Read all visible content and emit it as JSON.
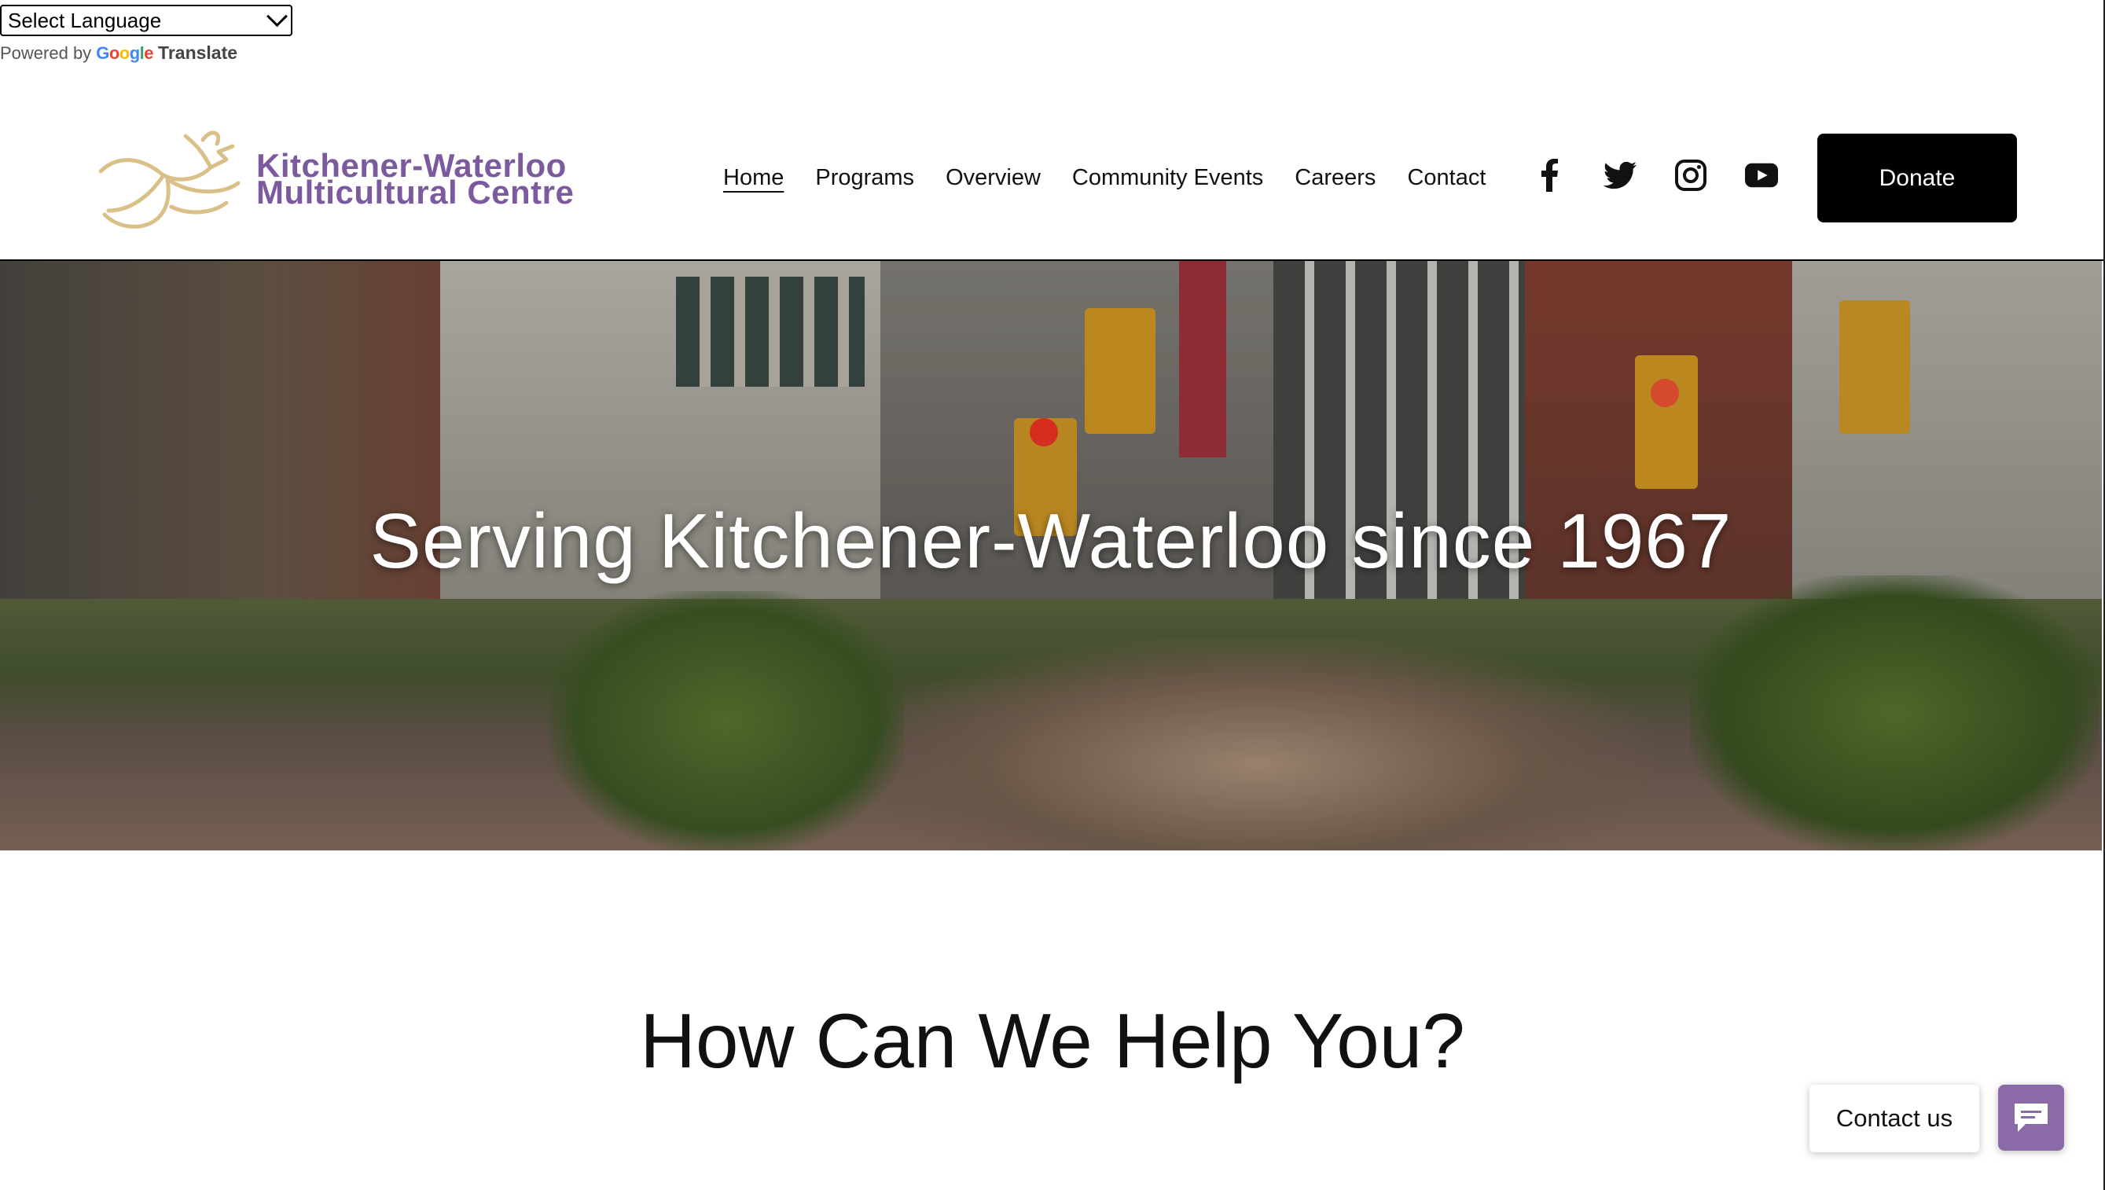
{
  "translate": {
    "select_value": "Select Language",
    "powered_by": "Powered by",
    "google": "Google",
    "translate_word": "Translate"
  },
  "logo": {
    "line1": "Kitchener-Waterloo",
    "line2": "Multicultural Centre"
  },
  "nav": {
    "items": [
      {
        "label": "Home",
        "active": true
      },
      {
        "label": "Programs"
      },
      {
        "label": "Overview"
      },
      {
        "label": "Community Events"
      },
      {
        "label": "Careers"
      },
      {
        "label": "Contact"
      }
    ]
  },
  "socials": [
    "facebook-icon",
    "twitter-icon",
    "instagram-icon",
    "youtube-icon"
  ],
  "donate_label": "Donate",
  "hero": {
    "title": "Serving Kitchener-Waterloo since 1967"
  },
  "section": {
    "title": "How Can We Help You?"
  },
  "contact_widget": {
    "label": "Contact us",
    "accent": "#8b6aa8"
  },
  "colors": {
    "logo_purple": "#7b5a9e",
    "logo_gold": "#d9c088",
    "donate_bg": "#000000"
  }
}
